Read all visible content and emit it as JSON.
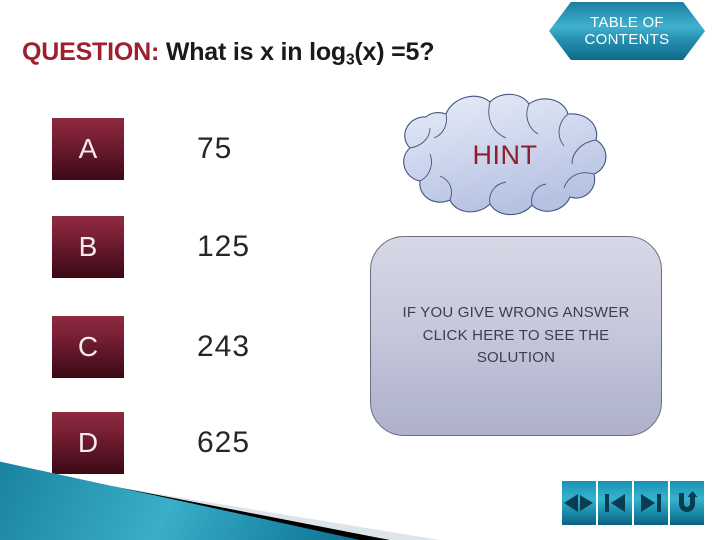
{
  "slide": {
    "toc_button": {
      "label": "TABLE OF\nCONTENTS",
      "icon": "hexagon-icon",
      "color": "#2793b4"
    },
    "question": {
      "label": "QUESTION:",
      "label_color": "#9e1f2f",
      "text_before": "What is x in log",
      "base": "3",
      "text_after": "(x) =5?",
      "full_text": "QUESTION: What is x in log3(x) =5?"
    },
    "answers": [
      {
        "letter": "A",
        "value": "75"
      },
      {
        "letter": "B",
        "value": "125"
      },
      {
        "letter": "C",
        "value": "243"
      },
      {
        "letter": "D",
        "value": "625"
      }
    ],
    "answer_box_color": "#7c2136",
    "hint": {
      "label": "HINT",
      "text_color": "#8f1d2c",
      "shape": "cloud-icon",
      "fill": "#ccd5ec",
      "outline": "#40547f"
    },
    "solution": {
      "text": "IF YOU GIVE WRONG ANSWER\nCLICK HERE TO SEE THE\nSOLUTION",
      "fill": "#c4c7da",
      "outline": "#6b6e86"
    },
    "nav_buttons": [
      {
        "name": "previous-next-button",
        "icon": "left-right-triangles-icon"
      },
      {
        "name": "first-slide-button",
        "icon": "skip-back-icon"
      },
      {
        "name": "next-slide-button",
        "icon": "skip-forward-icon"
      },
      {
        "name": "return-button",
        "icon": "return-arrow-icon"
      }
    ],
    "nav_color": "#1b8aaa",
    "decoration": {
      "teal": "#1d8aa8",
      "black": "#000000",
      "gray": "#dde5ea"
    }
  }
}
